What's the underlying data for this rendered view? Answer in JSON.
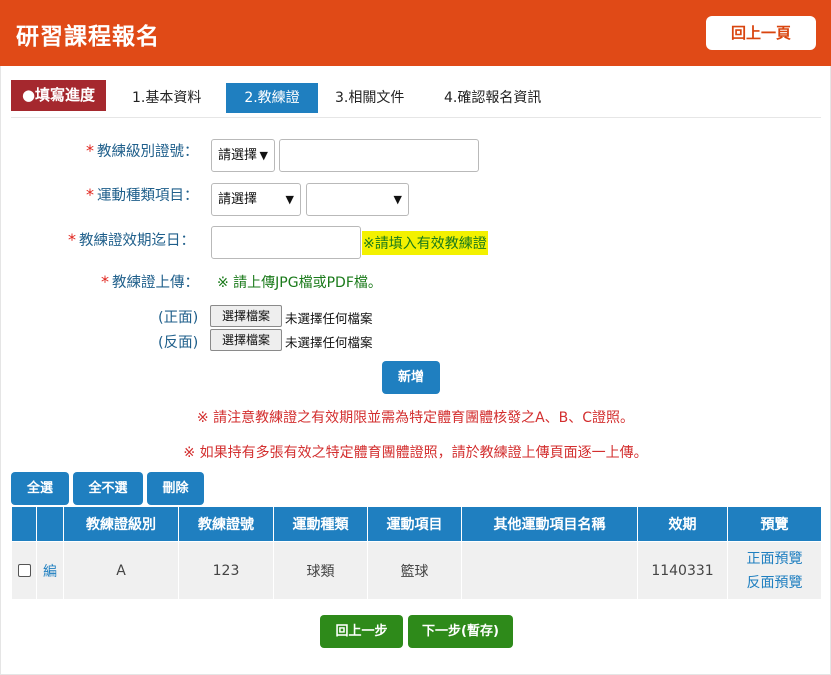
{
  "header": {
    "title": "研習課程報名",
    "back_label": "回上一頁"
  },
  "progress": {
    "badge": "●填寫進度"
  },
  "tabs": [
    {
      "label": "1.基本資料"
    },
    {
      "label": "2.教練證"
    },
    {
      "label": "3.相關文件"
    },
    {
      "label": "4.確認報名資訊"
    }
  ],
  "form": {
    "required_mark": "*",
    "level_label": "教練級別證號：",
    "level_select": "請選擇",
    "level_input": "",
    "sport_label": "運動種類項目：",
    "sport_select": "請選擇",
    "sport_item_select": "",
    "expiry_label": "教練證效期迄日：",
    "expiry_input": "",
    "expiry_hint": "※請填入有效教練證",
    "upload_label": "教練證上傳：",
    "upload_hint": "※ 請上傳JPG檔或PDF檔。",
    "front_label": "(正面)",
    "back_label": "(反面)",
    "choose_file": "選擇檔案",
    "no_file": "未選擇任何檔案",
    "add_button": "新增"
  },
  "notices": [
    "※ 請注意教練證之有效期限並需為特定體育團體核發之A、B、C證照。",
    "※ 如果持有多張有效之特定體育團體證照，請於教練證上傳頁面逐一上傳。"
  ],
  "actions": {
    "select_all": "全選",
    "deselect_all": "全不選",
    "delete": "刪除"
  },
  "table": {
    "headers": [
      "",
      "",
      "教練證級別",
      "教練證號",
      "運動種類",
      "運動項目",
      "其他運動項目名稱",
      "效期",
      "預覽"
    ],
    "rows": [
      {
        "edit": "編",
        "level": "A",
        "number": "123",
        "category": "球類",
        "item": "籃球",
        "other": "",
        "expiry": "1140331",
        "preview_front": "正面預覽",
        "preview_back": "反面預覽"
      }
    ]
  },
  "footer": {
    "prev_label": "回上一步",
    "next_label": "下一步(暫存)"
  },
  "colors": {
    "header_bg": "#e04a17",
    "badge_bg": "#a5282e",
    "primary_blue": "#1f7fc0",
    "green_button": "#2e8a1a",
    "hint_yellow": "#f3f100",
    "required_red": "#e0221b",
    "notice_red": "#d32f2f"
  }
}
